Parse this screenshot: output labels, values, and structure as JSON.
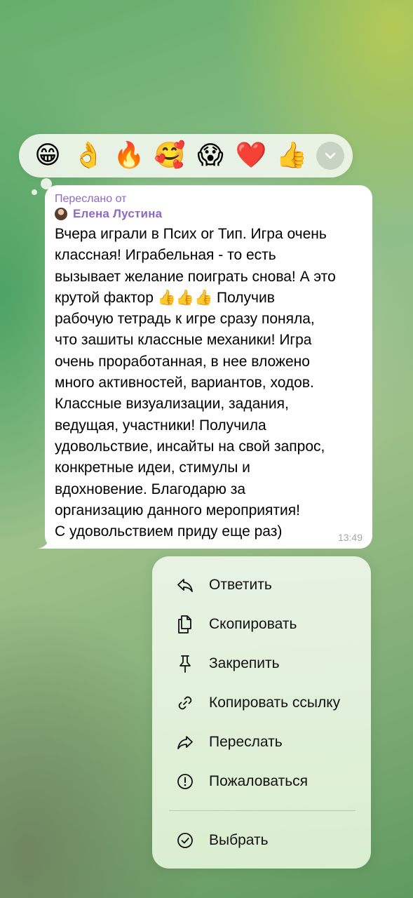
{
  "reactions": [
    {
      "icon": "grinning-face-emoji",
      "glyph": "😁"
    },
    {
      "icon": "ok-hand-emoji",
      "glyph": "👌"
    },
    {
      "icon": "fire-emoji",
      "glyph": "🔥"
    },
    {
      "icon": "smiling-face-with-hearts-emoji",
      "glyph": "🥰"
    },
    {
      "icon": "screaming-face-emoji",
      "glyph": "😱"
    },
    {
      "icon": "red-heart-emoji",
      "glyph": "❤️"
    },
    {
      "icon": "thumbs-up-emoji",
      "glyph": "👍"
    }
  ],
  "message": {
    "forwarded_label": "Переслано от",
    "author": "Елена Лустина",
    "text": "Вчера играли в Псих or Тип. Игра очень\nклассная! Играбельная - то есть\nвызывает желание поиграть снова! А это\nкрутой фактор 👍👍👍 Получив\nрабочую тетрадь к игре сразу поняла,\nчто зашиты классные механики! Игра\nочень проработанная, в нее вложено\nмного активностей, вариантов, ходов.\nКлассные визуализации, задания,\nведущая, участники! Получила\nудовольствие, инсайты на свой запрос,\nконкретные идеи, стимулы и\nвдохновение. Благодарю за\nорганизацию данного мероприятия!\nС удовольствием приду еще раз)",
    "time": "13:49"
  },
  "menu": {
    "reply": "Ответить",
    "copy": "Скопировать",
    "pin": "Закрепить",
    "copy_link": "Копировать ссылку",
    "forward": "Переслать",
    "report": "Пожаловаться",
    "select": "Выбрать"
  },
  "colors": {
    "accent_purple": "#8f68c7",
    "time_gray": "#a7a7a7"
  }
}
